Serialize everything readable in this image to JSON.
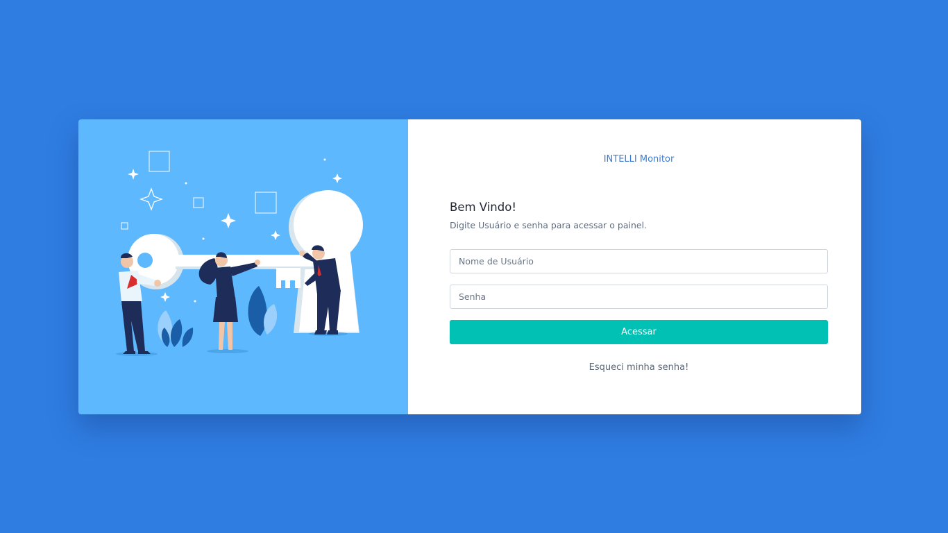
{
  "brand": {
    "title": "INTELLI Monitor"
  },
  "login": {
    "heading": "Bem Vindo!",
    "subtitle": "Digite Usuário e senha para acessar o painel.",
    "username_placeholder": "Nome de Usuário",
    "username_value": "",
    "password_placeholder": "Senha",
    "password_value": "",
    "submit_label": "Acessar",
    "forgot_label": "Esqueci minha senha!"
  },
  "illustration": {
    "name": "people-carrying-key-illustration",
    "icons": [
      "key-icon",
      "keyhole-icon",
      "sparkle-icon",
      "plant-icon"
    ]
  },
  "colors": {
    "page_background": "#2f7de1",
    "illustration_background": "#5eb8fd",
    "brand_text": "#3a7bd5",
    "button": "#00c1b4",
    "card": "#ffffff"
  }
}
